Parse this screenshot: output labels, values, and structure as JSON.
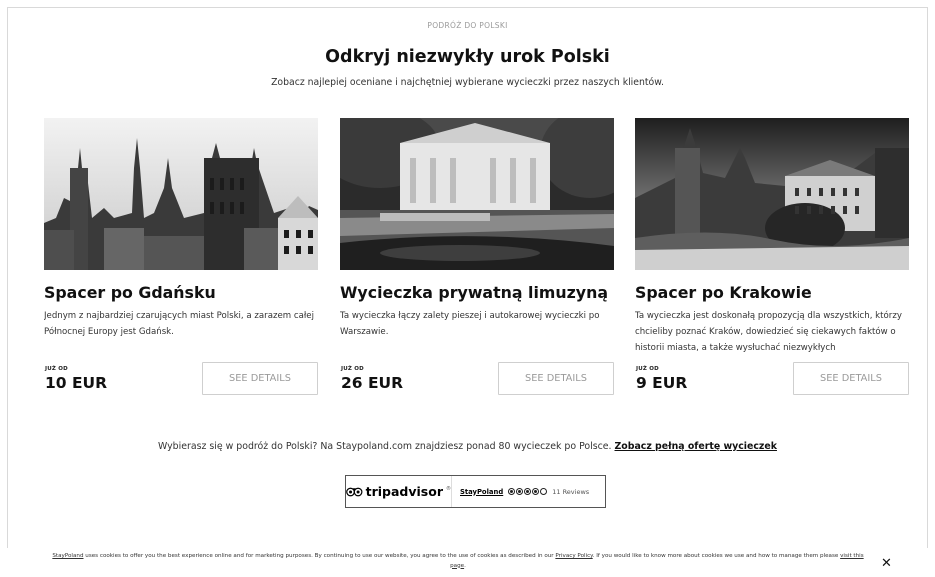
{
  "section": {
    "eyebrow": "PODRÓŻ DO POLSKI",
    "title": "Odkryj niezwykły urok Polski",
    "subtitle": "Zobacz najlepiej oceniane i najchętniej wybierane wycieczki przez naszych klientów."
  },
  "tours": [
    {
      "name": "Spacer po Gdańsku",
      "description": "Jednym z najbardziej czarujących miast Polski, a zarazem całej Północnej Europy jest Gdańsk.",
      "price_from": "JUŻ OD",
      "price": "10 EUR",
      "details_label": "SEE DETAILS"
    },
    {
      "name": "Wycieczka prywatną limuzyną",
      "description": "Ta wycieczka łączy zalety pieszej i autokarowej wycieczki po Warszawie.",
      "price_from": "JUŻ OD",
      "price": "26 EUR",
      "details_label": "SEE DETAILS"
    },
    {
      "name": "Spacer po Krakowie",
      "description": "Ta wycieczka jest doskonałą propozycją dla wszystkich, którzy chcieliby poznać Kraków, dowiedzieć się ciekawych faktów o historii miasta, a także wysłuchać niezwykłych",
      "price_from": "JUŻ OD",
      "price": "9 EUR",
      "details_label": "SEE DETAILS"
    }
  ],
  "promo": {
    "text": "Wybierasz się w podróż do Polski? Na Staypoland.com znajdziesz ponad 80 wycieczek po Polsce. ",
    "link": "Zobacz pełną ofertę wycieczek"
  },
  "tripadvisor": {
    "logo_text": "tripadvisor",
    "tm": "®",
    "brand": "StayPoland",
    "rating": 4,
    "rating_max": 5,
    "reviews": "11 Reviews"
  },
  "cookie": {
    "brand": "StayPoland",
    "text1": " uses cookies to offer you the best experience online and for marketing purposes. By continuing to use our website, you agree to the use of cookies as described in our ",
    "policy_link": "Privacy Policy",
    "text2": ". If you would like to know more about cookies we use and how to manage them please ",
    "visit_link": "visit this page",
    "text3": ".",
    "close_label": "✕"
  }
}
